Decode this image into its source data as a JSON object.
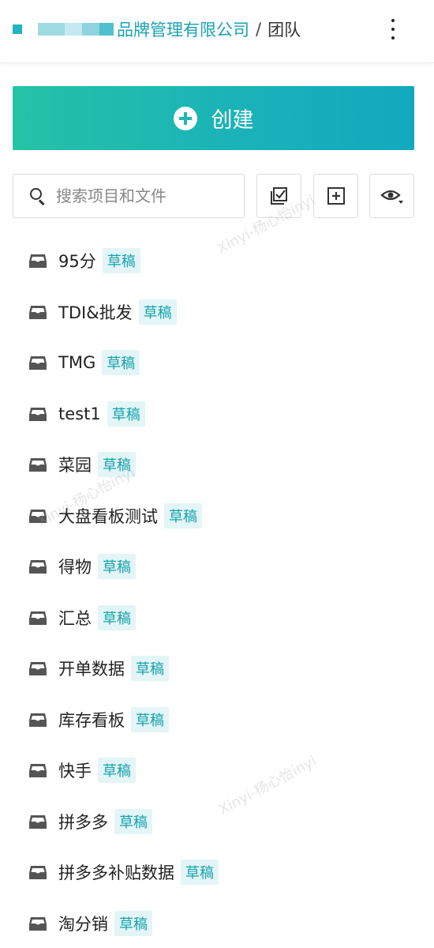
{
  "header": {
    "company": "品牌管理有限公司",
    "separator": "/",
    "current": "团队"
  },
  "create": {
    "label": "创建"
  },
  "search": {
    "placeholder": "搜索项目和文件"
  },
  "items": [
    {
      "name": "95分",
      "badge": "草稿"
    },
    {
      "name": "TDI&批发",
      "badge": "草稿"
    },
    {
      "name": "TMG",
      "badge": "草稿"
    },
    {
      "name": "test1",
      "badge": "草稿"
    },
    {
      "name": "菜园",
      "badge": "草稿"
    },
    {
      "name": "大盘看板测试",
      "badge": "草稿"
    },
    {
      "name": "得物",
      "badge": "草稿"
    },
    {
      "name": "汇总",
      "badge": "草稿"
    },
    {
      "name": "开单数据",
      "badge": "草稿"
    },
    {
      "name": "库存看板",
      "badge": "草稿"
    },
    {
      "name": "快手",
      "badge": "草稿"
    },
    {
      "name": "拼多多",
      "badge": "草稿"
    },
    {
      "name": "拼多多补贴数据",
      "badge": "草稿"
    },
    {
      "name": "淘分销",
      "badge": "草稿"
    }
  ],
  "watermark": "Xinyi-杨心怡inyi",
  "colors": {
    "accent": "#1aa3b1",
    "badge_bg": "#e3f5f6",
    "badge_text": "#15a3ae"
  }
}
